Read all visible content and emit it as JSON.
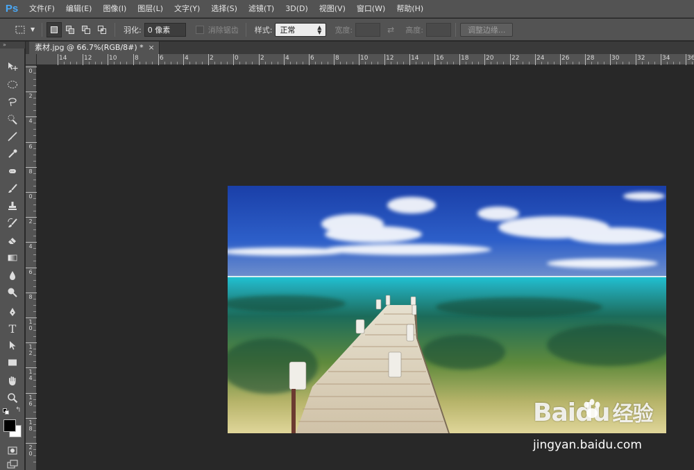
{
  "app": {
    "logo": "Ps"
  },
  "menu": [
    "文件(F)",
    "编辑(E)",
    "图像(I)",
    "图层(L)",
    "文字(Y)",
    "选择(S)",
    "滤镜(T)",
    "3D(D)",
    "视图(V)",
    "窗口(W)",
    "帮助(H)"
  ],
  "options": {
    "feather_label": "羽化:",
    "feather_value": "0 像素",
    "antialias_label": "消除锯齿",
    "style_label": "样式:",
    "style_value": "正常",
    "width_label": "宽度:",
    "height_label": "高度:",
    "refine_edge_label": "调整边缘..."
  },
  "document": {
    "tab_title": "素材.jpg @ 66.7%(RGB/8#) *",
    "close_glyph": "×"
  },
  "rulers": {
    "top_labels": [
      "14",
      "12",
      "10",
      "8",
      "6",
      "4",
      "2",
      "0",
      "2",
      "4",
      "6",
      "8",
      "10",
      "12",
      "14",
      "16",
      "18",
      "20",
      "22",
      "24",
      "26",
      "28",
      "30",
      "32",
      "34",
      "36"
    ],
    "left_labels": [
      "0",
      "2",
      "4",
      "6",
      "8",
      "0",
      "2",
      "4",
      "6",
      "8",
      "10",
      "12",
      "14",
      "16",
      "18",
      "20",
      "22"
    ]
  },
  "tools": [
    {
      "name": "move-tool-icon",
      "glyph": "move"
    },
    {
      "name": "elliptical-marquee-icon",
      "glyph": "ellipse"
    },
    {
      "name": "lasso-icon",
      "glyph": "lasso"
    },
    {
      "name": "quick-selection-icon",
      "glyph": "quick"
    },
    {
      "name": "crop-icon",
      "glyph": "crop"
    },
    {
      "name": "eyedropper-icon",
      "glyph": "eyedropper"
    },
    {
      "name": "spot-healing-icon",
      "glyph": "heal"
    },
    {
      "name": "brush-icon",
      "glyph": "brush"
    },
    {
      "name": "clone-stamp-icon",
      "glyph": "stamp"
    },
    {
      "name": "history-brush-icon",
      "glyph": "history"
    },
    {
      "name": "eraser-icon",
      "glyph": "eraser"
    },
    {
      "name": "gradient-icon",
      "glyph": "gradient"
    },
    {
      "name": "blur-icon",
      "glyph": "blur"
    },
    {
      "name": "dodge-icon",
      "glyph": "dodge"
    },
    {
      "name": "pen-icon",
      "glyph": "pen"
    },
    {
      "name": "type-icon",
      "glyph": "T"
    },
    {
      "name": "path-selection-icon",
      "glyph": "arrow"
    },
    {
      "name": "rectangle-shape-icon",
      "glyph": "rect"
    },
    {
      "name": "hand-icon",
      "glyph": "hand"
    },
    {
      "name": "zoom-icon",
      "glyph": "zoom"
    }
  ],
  "colors": {
    "foreground": "#000000",
    "background": "#ffffff",
    "accent": "#4aa8f5"
  },
  "watermark": {
    "brand": "Baidu",
    "cn": "经验",
    "url": "jingyan.baidu.com"
  }
}
